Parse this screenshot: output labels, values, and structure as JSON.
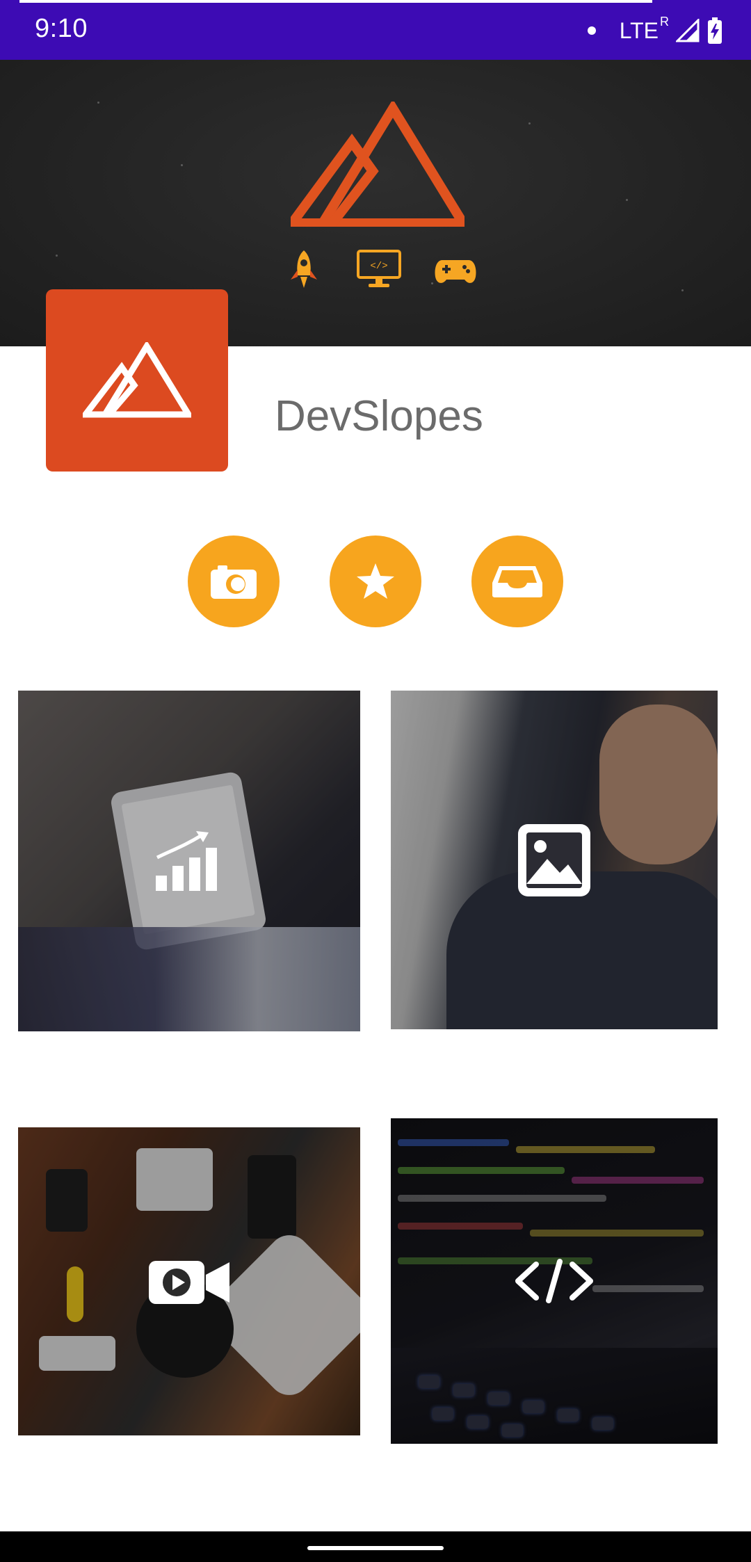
{
  "status_bar": {
    "time": "9:10",
    "network": "LTE",
    "roaming": "R",
    "icons": [
      "notification-dot-icon",
      "signal-icon",
      "battery-charging-icon"
    ]
  },
  "banner": {
    "logo": "mountain-logo-icon",
    "icons": [
      "rocket-icon",
      "code-monitor-icon",
      "gamepad-icon"
    ],
    "accent_color": "#e0531f",
    "icon_color": "#f6a623"
  },
  "profile": {
    "name": "DevSlopes",
    "avatar_color": "#dc4a20"
  },
  "actions": [
    {
      "icon": "camera-icon"
    },
    {
      "icon": "star-icon"
    },
    {
      "icon": "inbox-icon"
    }
  ],
  "action_color": "#f7a51e",
  "tiles": [
    {
      "icon": "bar-chart-icon"
    },
    {
      "icon": "image-icon"
    },
    {
      "icon": "video-camera-icon"
    },
    {
      "icon": "code-icon"
    }
  ]
}
